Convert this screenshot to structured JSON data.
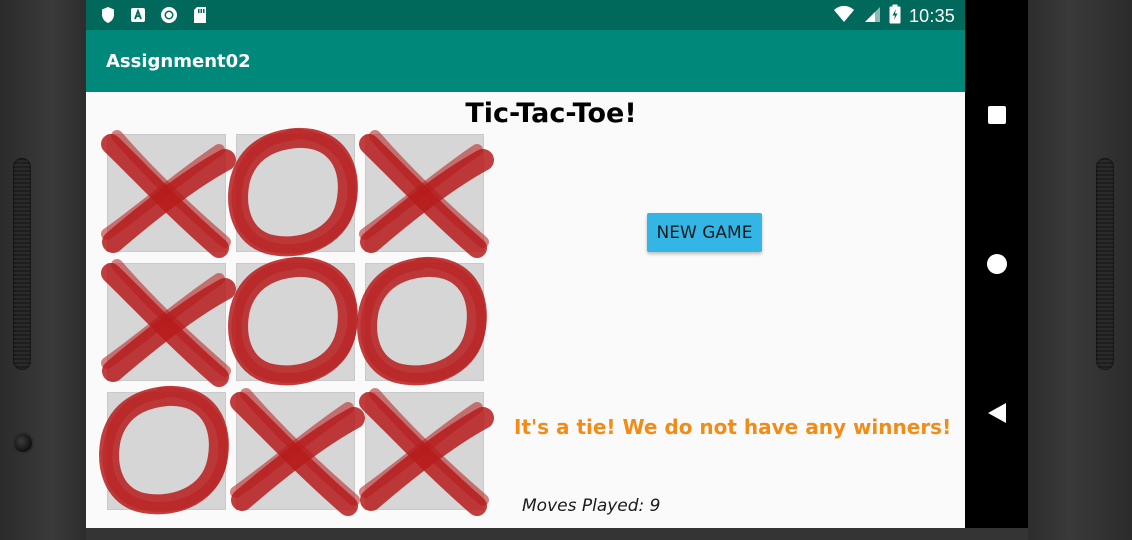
{
  "status_bar": {
    "time": "10:35",
    "left_icons": [
      "shield-icon",
      "app-a-icon",
      "record-icon",
      "sdcard-icon"
    ],
    "right_icons": [
      "wifi-icon",
      "signal-icon",
      "battery-icon"
    ],
    "background": "#00695c"
  },
  "app_bar": {
    "title": "Assignment02",
    "background": "#00897b"
  },
  "game": {
    "title": "Tic-Tac-Toe!",
    "board": [
      [
        "X",
        "O",
        "X"
      ],
      [
        "X",
        "O",
        "O"
      ],
      [
        "O",
        "X",
        "X"
      ]
    ],
    "mark_color": "#b71c1c",
    "new_game_label": "NEW GAME",
    "new_game_color": "#33b5e5",
    "result_message": "It's a tie! We do not have any winners!",
    "result_color": "#f28c16",
    "moves_label": "Moves Played: 9"
  },
  "nav_bar": {
    "buttons": [
      "overview-square-icon",
      "home-circle-icon",
      "back-triangle-icon"
    ]
  }
}
